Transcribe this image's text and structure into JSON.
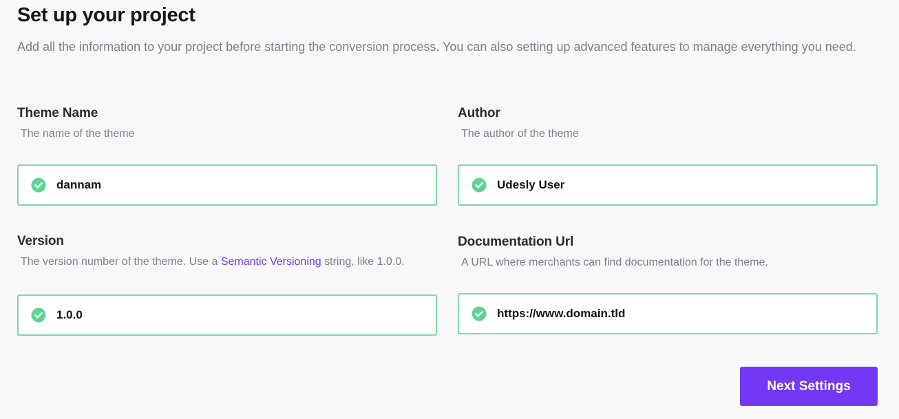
{
  "header": {
    "title": "Set up your project",
    "description": "Add all the information to your project before starting the conversion process. You can also setting up advanced features to manage everything you need."
  },
  "fields": {
    "theme_name": {
      "label": "Theme Name",
      "help": "The name of the theme",
      "value": "dannam",
      "status_icon": "check-circle-icon"
    },
    "author": {
      "label": "Author",
      "help": "The author of the theme",
      "value": "Udesly User",
      "status_icon": "check-circle-icon"
    },
    "version": {
      "label": "Version",
      "help_before_link": "The version number of the theme. Use a ",
      "help_link": "Semantic Versioning",
      "help_after_link": " string, like 1.0.0.",
      "value": "1.0.0",
      "status_icon": "check-circle-icon"
    },
    "documentation_url": {
      "label": "Documentation Url",
      "help": "A URL where merchants can find documentation for the theme.",
      "value": "https://www.domain.tld",
      "status_icon": "check-circle-icon"
    }
  },
  "actions": {
    "next_label": "Next Settings"
  },
  "colors": {
    "accent": "#7338f4",
    "link": "#6d3bf0",
    "valid_border": "#7fd8a6",
    "valid_icon": "#5fd394",
    "background": "#f8f8fa"
  }
}
